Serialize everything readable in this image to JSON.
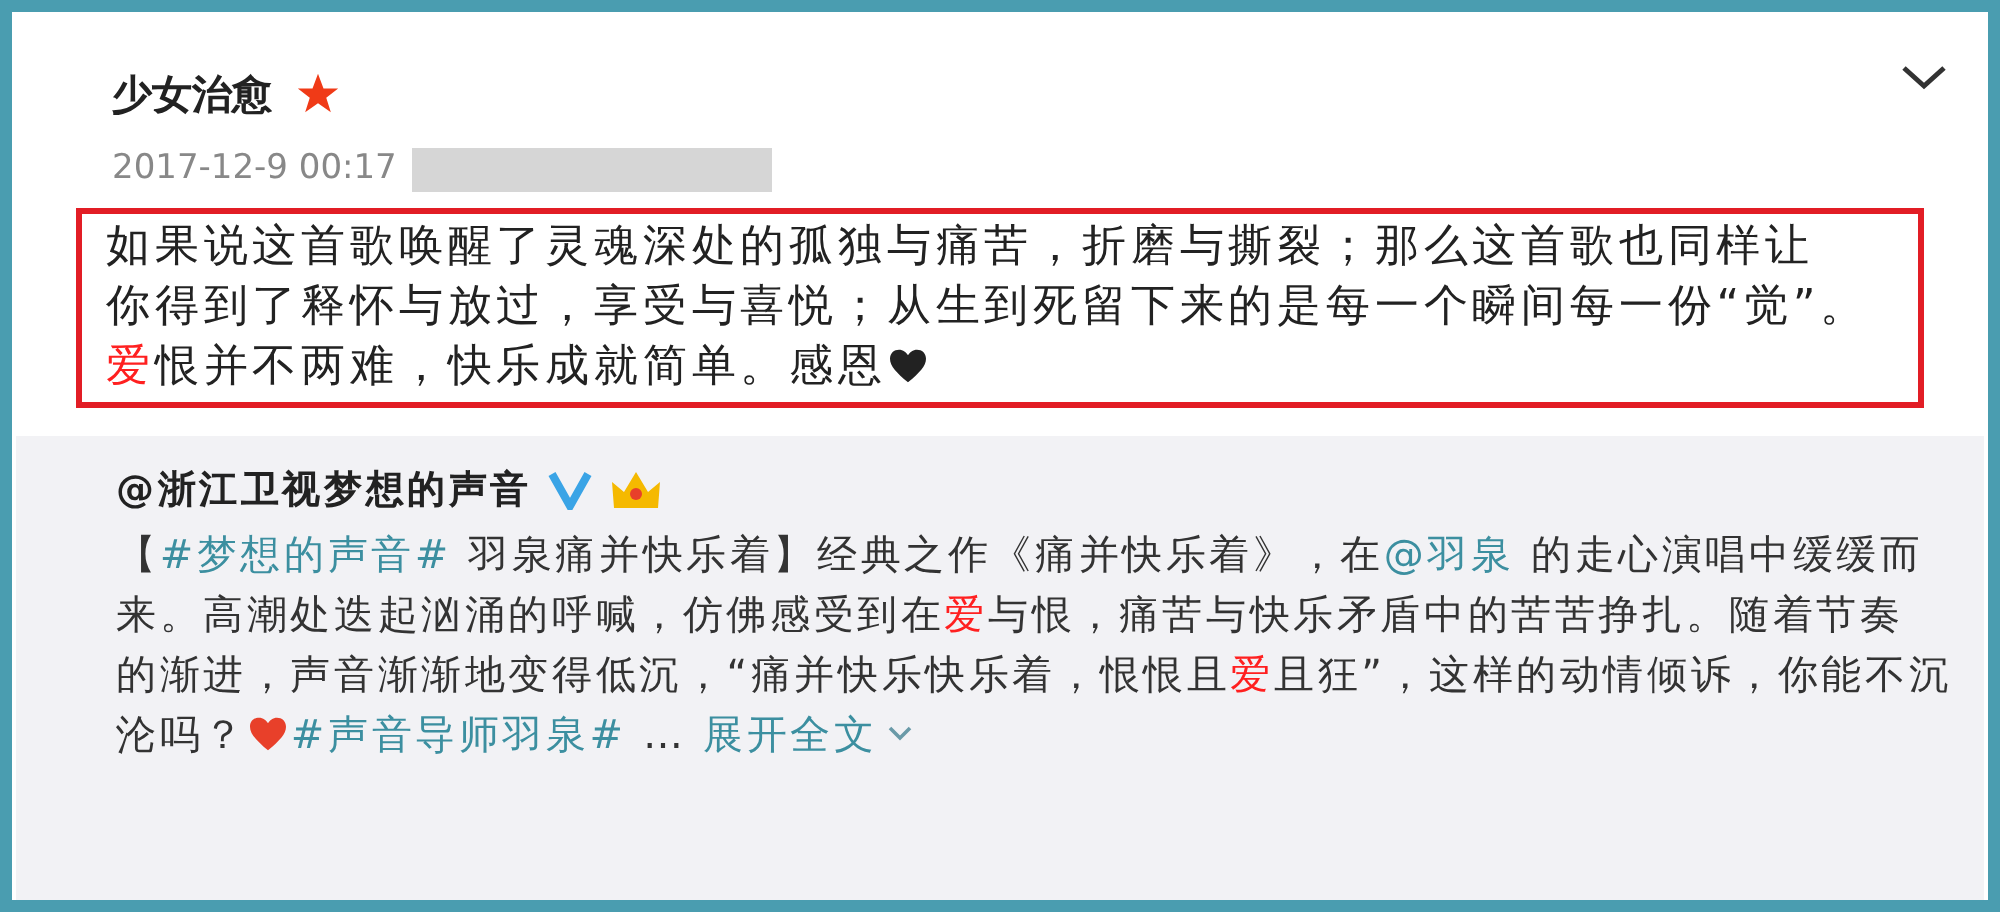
{
  "post": {
    "author": "少女治愈",
    "time": "2017-12-9 00:17",
    "comment_lines": [
      [
        {
          "kind": "text",
          "text": "如果说这首歌唤醒了灵魂深处的孤独与痛苦，折磨与撕裂；那么这首歌也同样让"
        }
      ],
      [
        {
          "kind": "text",
          "text": "你得到了释怀与放过，享受与喜悦；从生到死留下来的是每一个瞬间每一份“觉”。"
        }
      ],
      [
        {
          "kind": "red",
          "text": "爱"
        },
        {
          "kind": "text",
          "text": "恨并不两难，快乐成就简单。感恩"
        },
        {
          "kind": "heart",
          "color": "#222222"
        }
      ]
    ]
  },
  "repost": {
    "author": "@浙江卫视梦想的声音",
    "lines": [
      [
        {
          "kind": "text",
          "text": "【"
        },
        {
          "kind": "link",
          "text": "#梦想的声音#"
        },
        {
          "kind": "text",
          "text": " 羽泉痛并快乐着】经典之作《痛并快乐着》，在"
        },
        {
          "kind": "link",
          "text": "@羽泉"
        },
        {
          "kind": "text",
          "text": " 的走心演唱中缓缓而"
        }
      ],
      [
        {
          "kind": "text",
          "text": "来。高潮处迭起汹涌的呼喊，仿佛感受到在"
        },
        {
          "kind": "red",
          "text": "爱"
        },
        {
          "kind": "text",
          "text": "与恨，痛苦与快乐矛盾中的苦苦挣扎。随着节奏"
        }
      ],
      [
        {
          "kind": "text",
          "text": "的渐进，声音渐渐地变得低沉，“痛并快乐快乐着，恨恨且"
        },
        {
          "kind": "red",
          "text": "爱"
        },
        {
          "kind": "text",
          "text": "且狂”，这样的动情倾诉，你能不沉"
        }
      ],
      [
        {
          "kind": "text",
          "text": "沦吗？"
        },
        {
          "kind": "heart",
          "color": "#e8402a"
        },
        {
          "kind": "link",
          "text": "#声音导师羽泉#"
        },
        {
          "kind": "text",
          "text": " … "
        },
        {
          "kind": "expand",
          "text": "展开全文"
        }
      ]
    ]
  }
}
